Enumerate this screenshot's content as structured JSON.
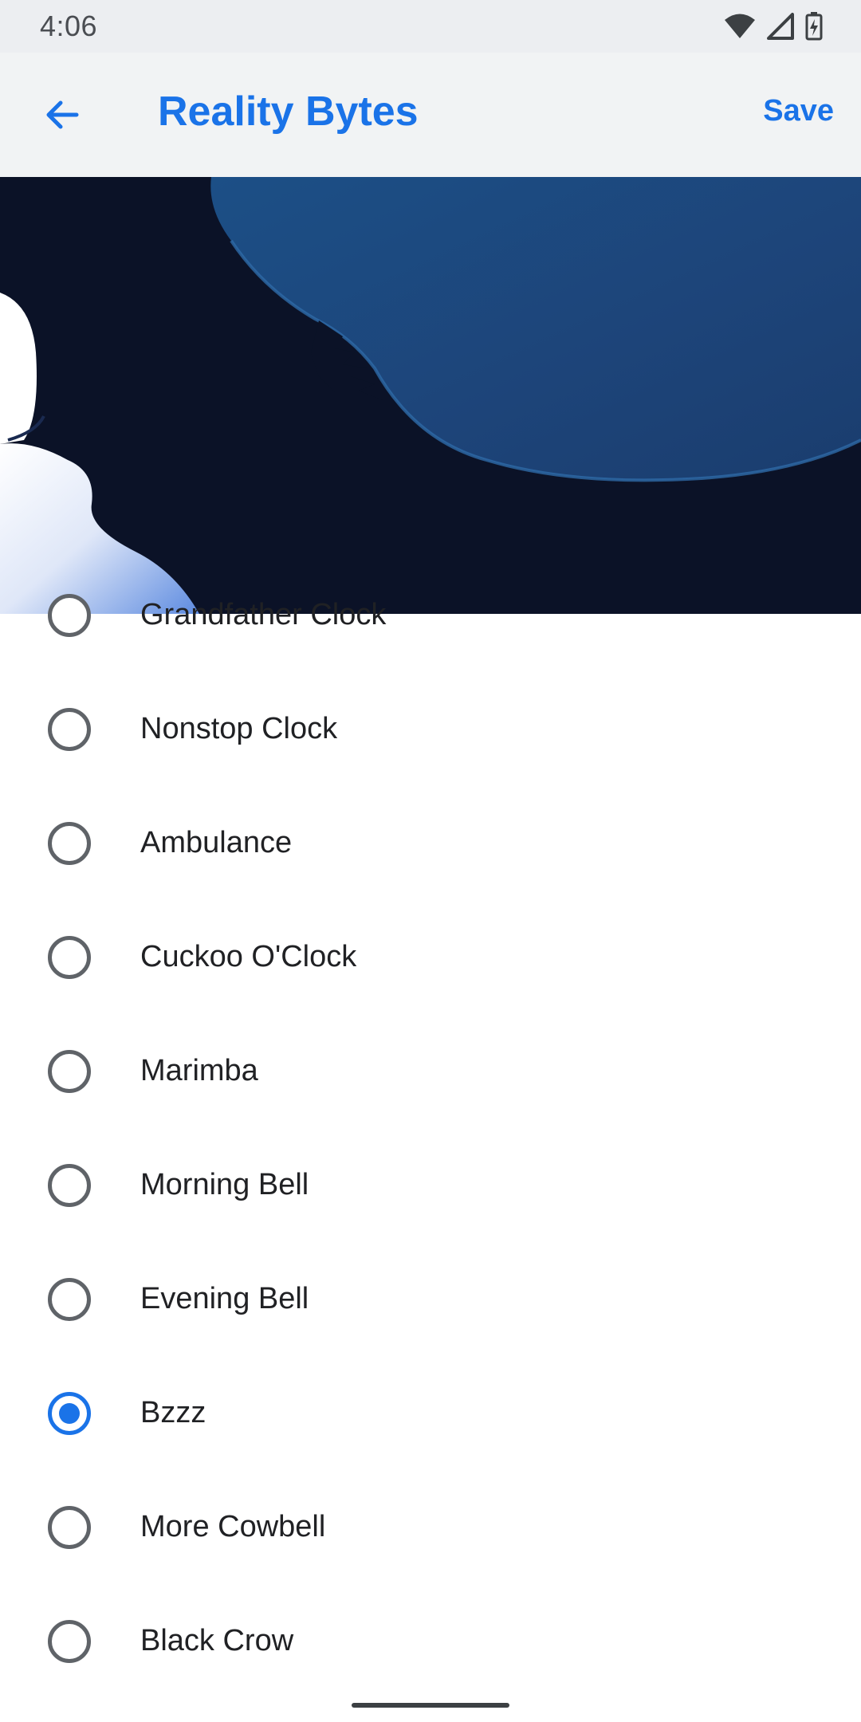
{
  "status_bar": {
    "time": "4:06",
    "icons": [
      "wifi-icon",
      "cell-signal-icon",
      "battery-charging-icon"
    ]
  },
  "app_bar": {
    "back_icon": "arrow-back-icon",
    "title": "Reality Bytes",
    "save_label": "Save"
  },
  "colors": {
    "accent": "#1a73e8",
    "radio_unselected": "#5f6368",
    "app_bar_bg": "#f1f3f4"
  },
  "sounds": [
    {
      "label": "Grandfather Clock",
      "selected": false
    },
    {
      "label": "Nonstop Clock",
      "selected": false
    },
    {
      "label": "Ambulance",
      "selected": false
    },
    {
      "label": "Cuckoo O'Clock",
      "selected": false
    },
    {
      "label": "Marimba",
      "selected": false
    },
    {
      "label": "Morning Bell",
      "selected": false
    },
    {
      "label": "Evening Bell",
      "selected": false
    },
    {
      "label": "Bzzz",
      "selected": true
    },
    {
      "label": "More Cowbell",
      "selected": false
    },
    {
      "label": "Black Crow",
      "selected": false
    }
  ]
}
